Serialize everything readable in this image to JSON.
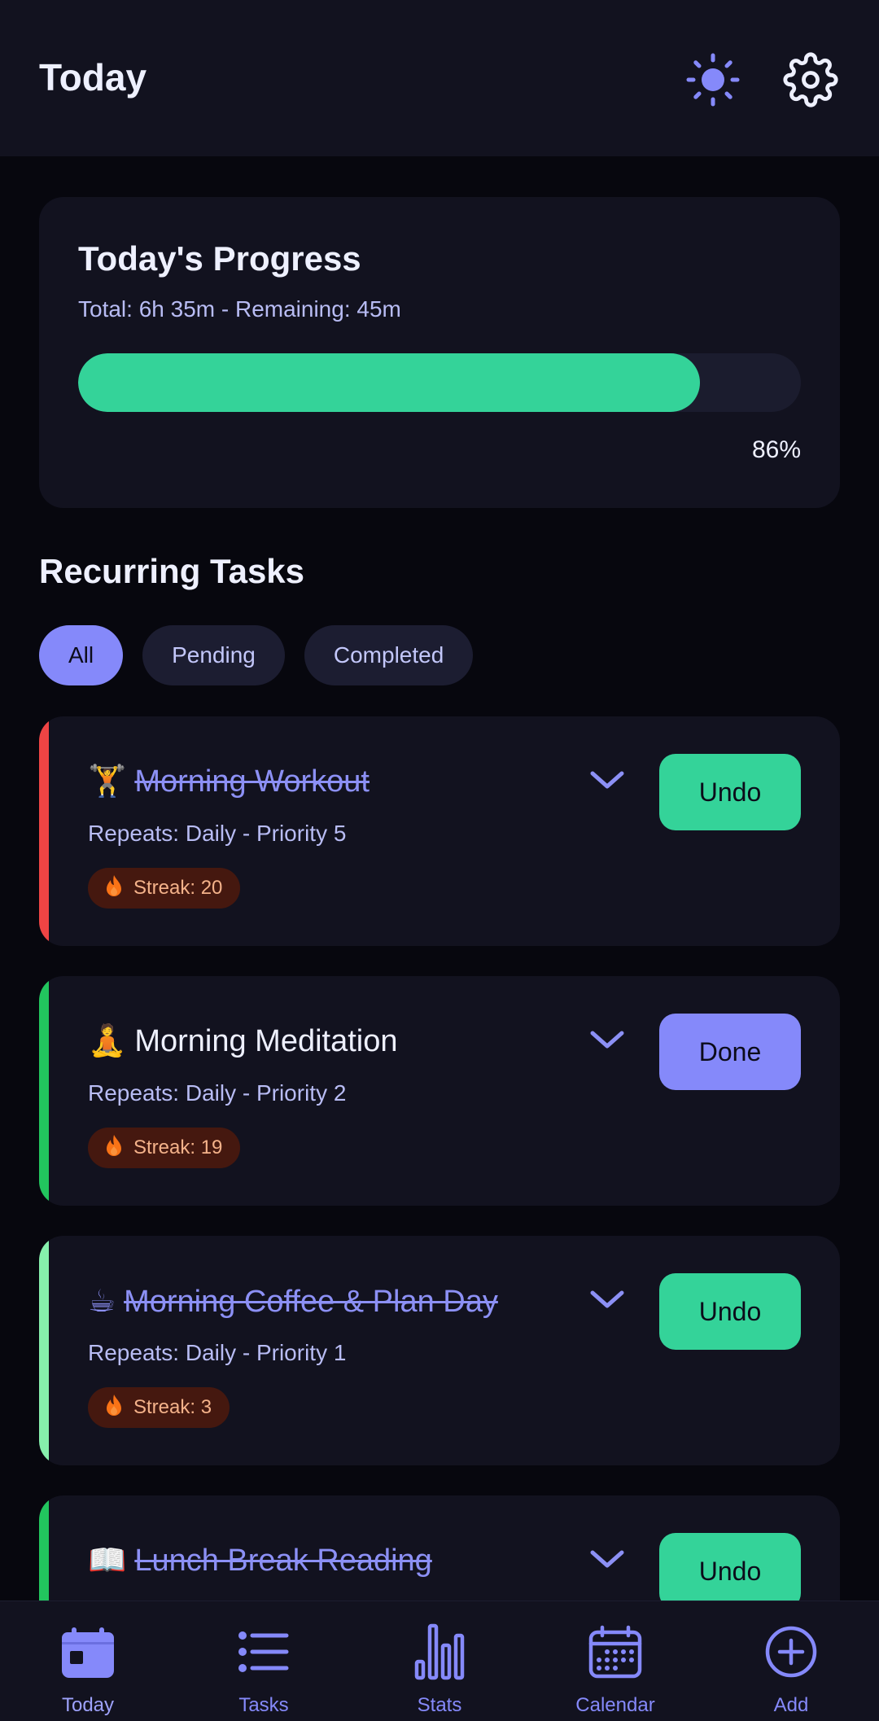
{
  "header": {
    "title": "Today",
    "theme_icon": "sun-icon",
    "settings_icon": "gear-icon"
  },
  "progress": {
    "title": "Today's Progress",
    "subtitle": "Total: 6h 35m - Remaining: 45m",
    "percent_label": "86%",
    "fraction": 0.86
  },
  "section": {
    "title": "Recurring Tasks"
  },
  "filters": [
    {
      "label": "All",
      "active": true
    },
    {
      "label": "Pending",
      "active": false
    },
    {
      "label": "Completed",
      "active": false
    }
  ],
  "tasks": [
    {
      "emoji": "🏋️",
      "name": "Morning Workout",
      "meta": "Repeats: Daily - Priority 5",
      "streak": "Streak: 20",
      "completed": true,
      "action": "Undo",
      "accent": "#ef4444"
    },
    {
      "emoji": "🧘",
      "name": "Morning Meditation",
      "meta": "Repeats: Daily - Priority 2",
      "streak": "Streak: 19",
      "completed": false,
      "action": "Done",
      "accent": "#22c55e"
    },
    {
      "emoji": "☕",
      "name": "Morning Coffee & Plan Day",
      "meta": "Repeats: Daily - Priority 1",
      "streak": "Streak: 3",
      "completed": true,
      "action": "Undo",
      "accent": "#86efac"
    },
    {
      "emoji": "📖",
      "name": "Lunch Break Reading",
      "meta": "",
      "streak": "",
      "completed": true,
      "action": "Undo",
      "accent": "#22c55e"
    }
  ],
  "nav": [
    {
      "label": "Today",
      "icon": "calendar-day-icon",
      "active": true
    },
    {
      "label": "Tasks",
      "icon": "list-icon",
      "active": false
    },
    {
      "label": "Stats",
      "icon": "bar-chart-icon",
      "active": false
    },
    {
      "label": "Calendar",
      "icon": "calendar-icon",
      "active": false
    },
    {
      "label": "Add",
      "icon": "plus-circle-icon",
      "active": false
    }
  ],
  "colors": {
    "accent": "#8589fa",
    "success": "#34d399",
    "background": "#07070e",
    "card": "#12121f"
  }
}
